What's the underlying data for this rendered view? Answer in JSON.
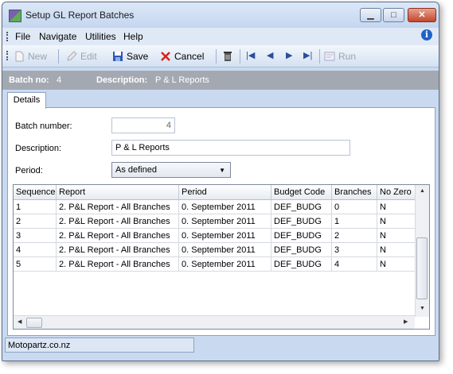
{
  "window": {
    "title": "Setup GL Report Batches"
  },
  "menu": {
    "items": [
      "File",
      "Navigate",
      "Utilities",
      "Help"
    ]
  },
  "toolbar": {
    "new": "New",
    "edit": "Edit",
    "save": "Save",
    "cancel": "Cancel",
    "run": "Run"
  },
  "header": {
    "batch_label": "Batch no:",
    "batch_value": "4",
    "desc_label": "Description:",
    "desc_value": "P & L Reports"
  },
  "tabs": {
    "details": "Details"
  },
  "form": {
    "batch_number_label": "Batch number:",
    "batch_number_value": "4",
    "description_label": "Description:",
    "description_value": "P & L Reports",
    "period_label": "Period:",
    "period_value": "As defined"
  },
  "grid": {
    "columns": [
      "Sequence",
      "Report",
      "Period",
      "Budget Code",
      "Branches",
      "No Zero"
    ],
    "rows": [
      [
        "1",
        "2. P&L Report - All Branches",
        "0. September 2011",
        "DEF_BUDG",
        "0",
        "N"
      ],
      [
        "2",
        "2. P&L Report - All Branches",
        "0. September 2011",
        "DEF_BUDG",
        "1",
        "N"
      ],
      [
        "3",
        "2. P&L Report - All Branches",
        "0. September 2011",
        "DEF_BUDG",
        "2",
        "N"
      ],
      [
        "4",
        "2. P&L Report - All Branches",
        "0. September 2011",
        "DEF_BUDG",
        "3",
        "N"
      ],
      [
        "5",
        "2. P&L Report - All Branches",
        "0. September 2011",
        "DEF_BUDG",
        "4",
        "N"
      ]
    ]
  },
  "status": {
    "text": "Motopartz.co.nz"
  }
}
